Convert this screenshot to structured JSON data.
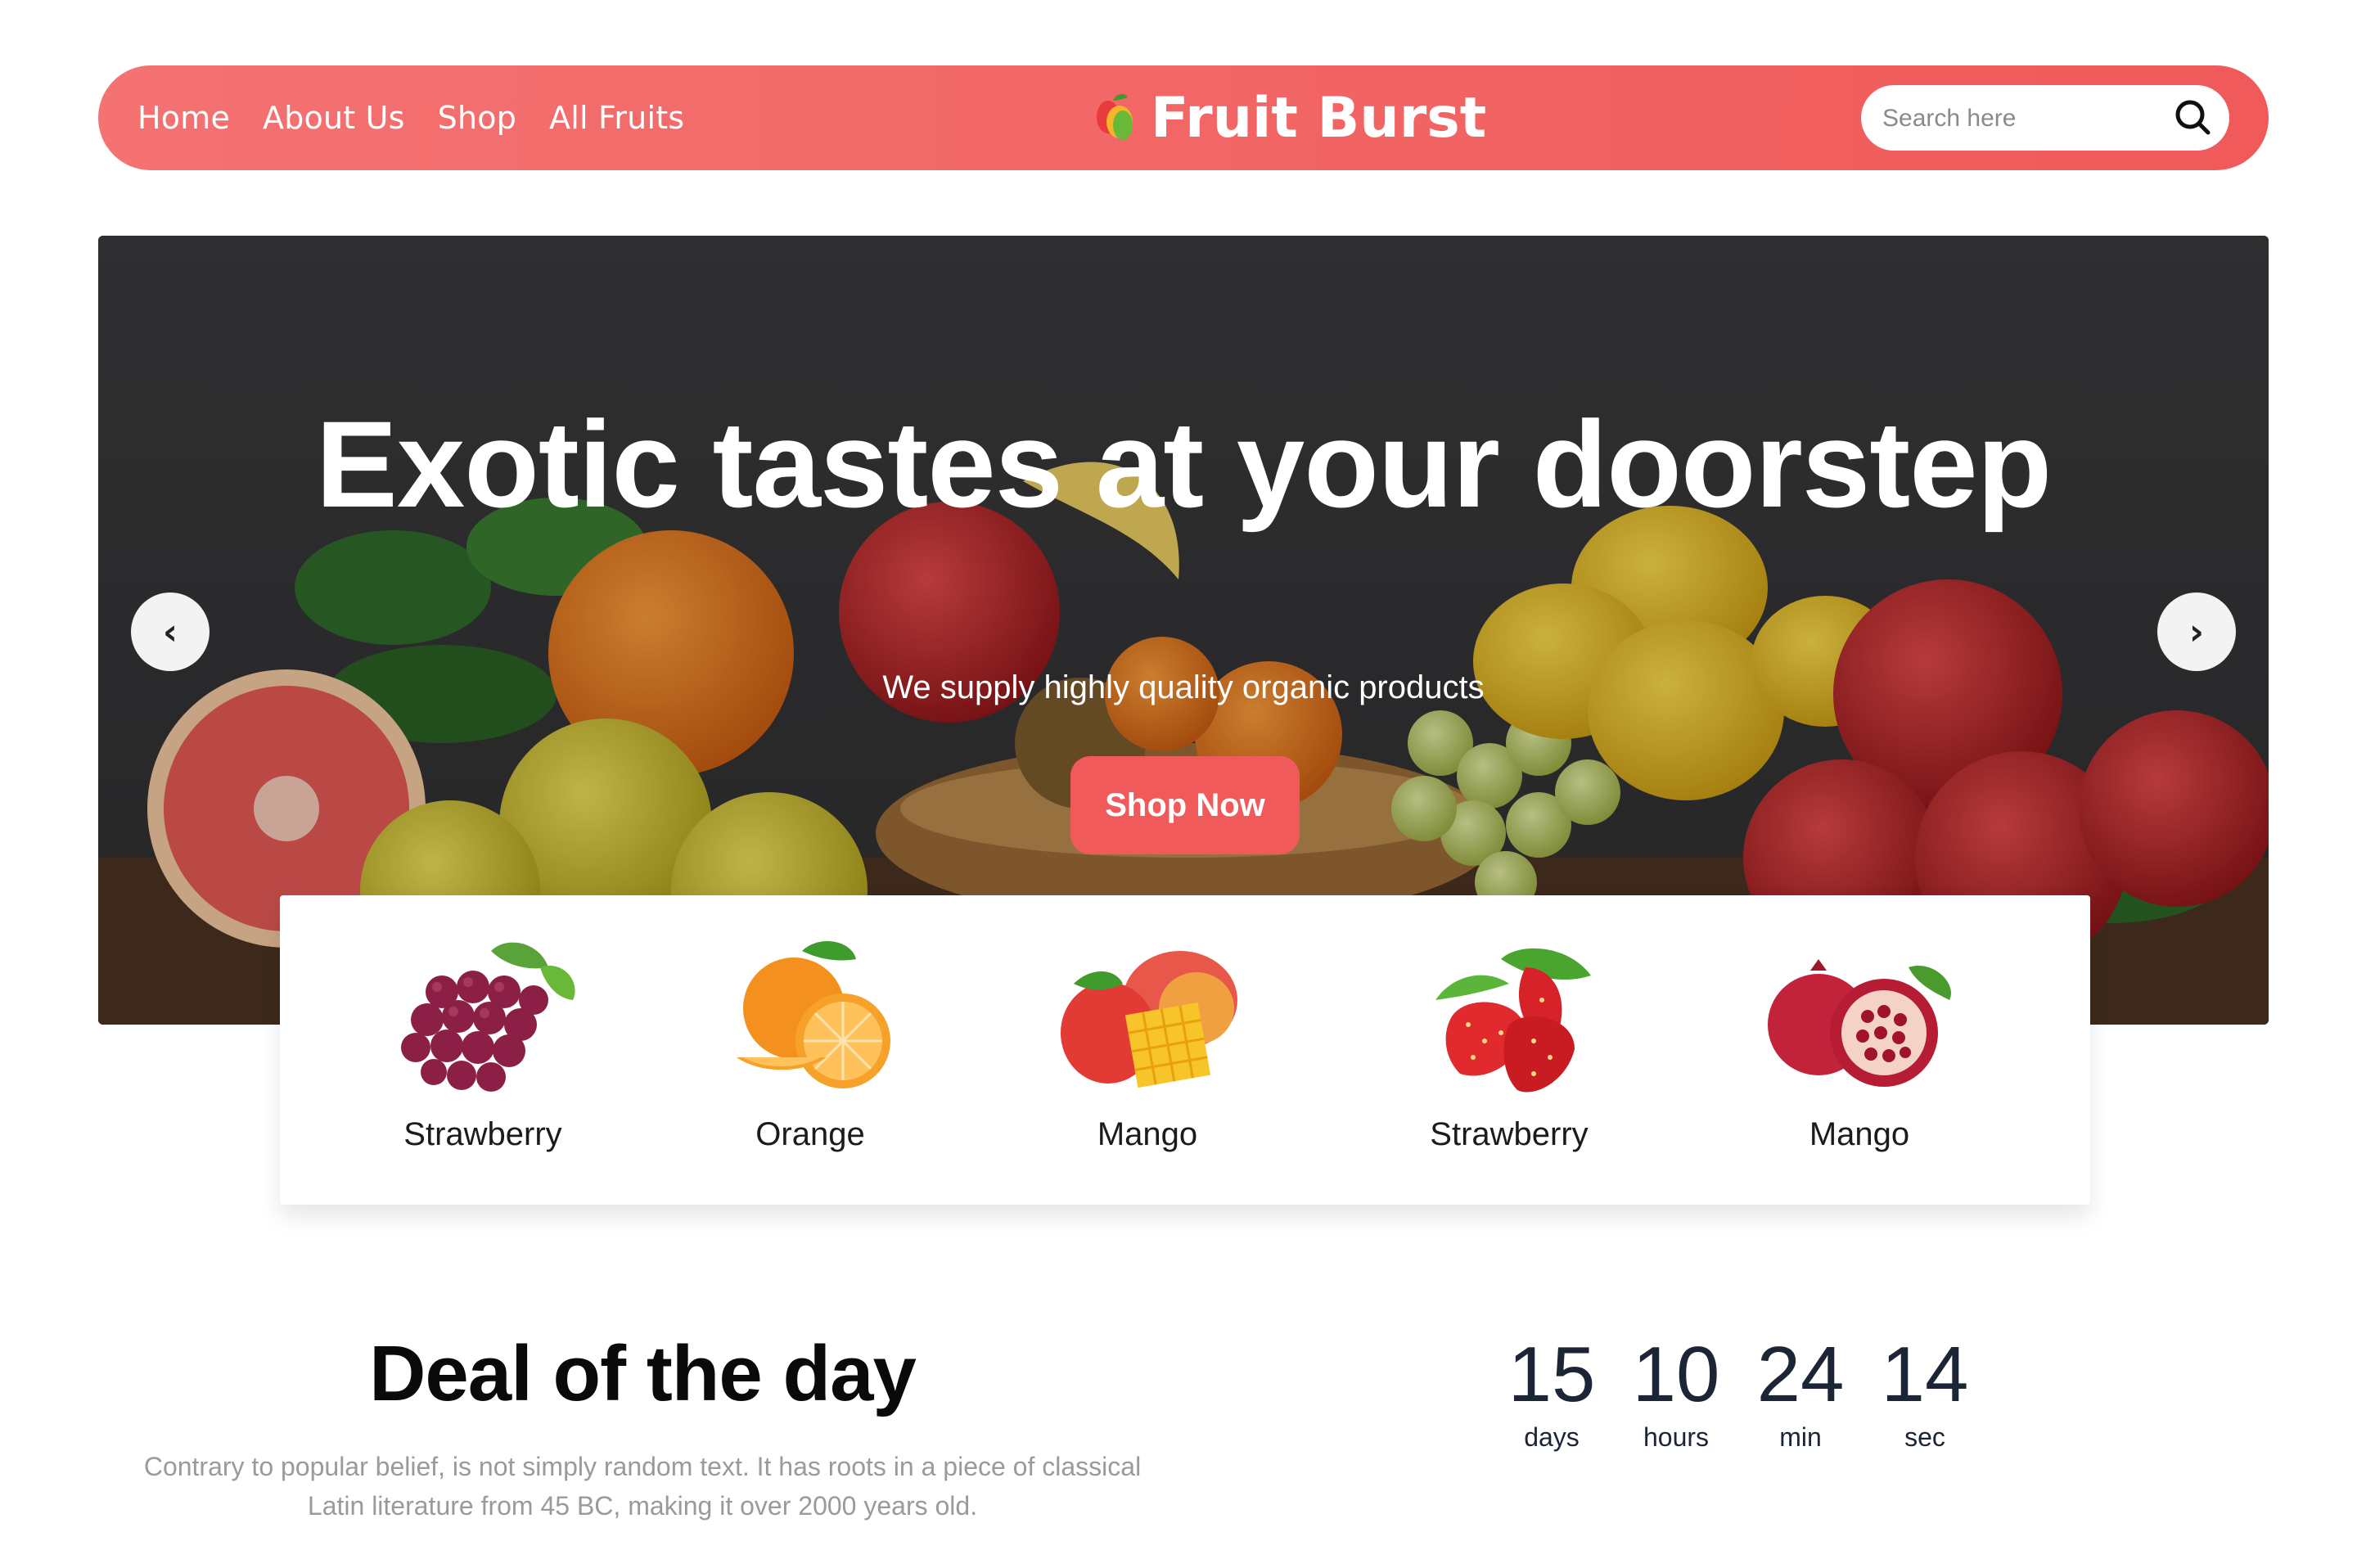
{
  "nav": {
    "links": [
      "Home",
      "About Us",
      "Shop",
      "All Fruits"
    ],
    "brand": "Fruit Burst",
    "search_placeholder": "Search here"
  },
  "hero": {
    "title": "Exotic tastes at your doorstep",
    "subtitle": "We supply highly quality organic products",
    "cta": "Shop Now",
    "prev_icon": "‹",
    "next_icon": "›"
  },
  "categories": [
    {
      "label": "Strawberry",
      "icon": "grapes-image"
    },
    {
      "label": "Orange",
      "icon": "orange-image"
    },
    {
      "label": "Mango",
      "icon": "mango-image"
    },
    {
      "label": "Strawberry",
      "icon": "strawberry-image"
    },
    {
      "label": "Mango",
      "icon": "pomegranate-image"
    }
  ],
  "deal": {
    "title": "Deal of the day",
    "text": "Contrary to popular belief, is not simply random text. It has roots in a piece of classical Latin literature from 45 BC, making it over 2000 years old."
  },
  "countdown": [
    {
      "value": "15",
      "label": "days"
    },
    {
      "value": "10",
      "label": "hours"
    },
    {
      "value": "24",
      "label": "min"
    },
    {
      "value": "14",
      "label": "sec"
    }
  ],
  "colors": {
    "accent": "#f05a5a",
    "accent_light": "#f47272",
    "hero_bg": "#3a3a3c",
    "countdown_text": "#1c2535"
  }
}
